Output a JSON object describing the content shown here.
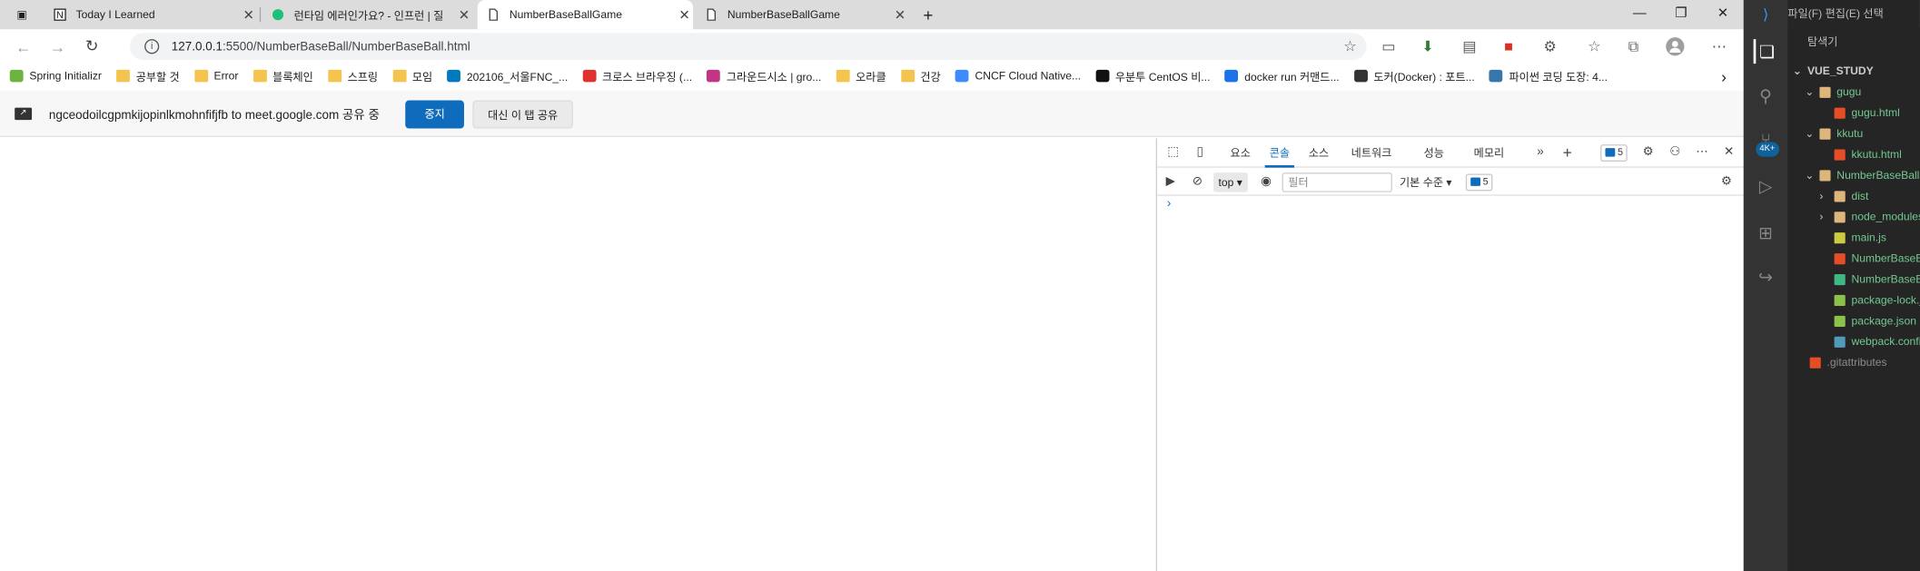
{
  "browser": {
    "tabs": [
      {
        "title": "Today I Learned",
        "icon": "notion-icon",
        "active": false
      },
      {
        "title": "런타임 에러인가요? - 인프런 | 질",
        "icon": "inflearn-icon",
        "active": false
      },
      {
        "title": "NumberBaseBallGame",
        "icon": "page-icon",
        "active": true
      },
      {
        "title": "NumberBaseBallGame",
        "icon": "page-icon",
        "active": false
      }
    ],
    "new_tab": "+",
    "url_host": "127.0.0.1",
    "url_path": ":5500/NumberBaseBall/NumberBaseBall.html",
    "bookmarks": [
      {
        "label": "Spring Initializr",
        "icon": "spring-icon"
      },
      {
        "label": "공부할 것",
        "icon": "folder-icon"
      },
      {
        "label": "Error",
        "icon": "folder-icon"
      },
      {
        "label": "블록체인",
        "icon": "folder-icon"
      },
      {
        "label": "스프링",
        "icon": "folder-icon"
      },
      {
        "label": "모임",
        "icon": "folder-icon"
      },
      {
        "label": "202106_서울FNC_...",
        "icon": "trello-icon"
      },
      {
        "label": "크로스 브라우징 (...",
        "icon": "w-icon"
      },
      {
        "label": "그라운드시소 | gro...",
        "icon": "instagram-icon"
      },
      {
        "label": "오라클",
        "icon": "folder-icon"
      },
      {
        "label": "건강",
        "icon": "folder-icon"
      },
      {
        "label": "CNCF Cloud Native...",
        "icon": "image-icon"
      },
      {
        "label": "우분투 CentOS 비...",
        "icon": "x-icon"
      },
      {
        "label": "docker run 커맨드...",
        "icon": "file-icon"
      },
      {
        "label": "도커(Docker) : 포트...",
        "icon": "dots-icon"
      },
      {
        "label": "파이썬 코딩 도장: 4...",
        "icon": "python-icon"
      }
    ],
    "infobar": {
      "message": "ngceodoilcgpmkijopinlkmohnfifjfb to meet.google.com 공유 중",
      "stop_label": "중지",
      "share_label": "대신 이 탭 공유"
    }
  },
  "devtools": {
    "tabs": [
      "요소",
      "콘솔",
      "소스",
      "네트워크",
      "성능",
      "메모리"
    ],
    "selected_tab": "콘솔",
    "more": "»",
    "add": "+",
    "issues_count": "5",
    "context": "top ▾",
    "filter_placeholder": "필터",
    "level": "기본 수준 ▾",
    "console_issues": "5",
    "prompt": "›"
  },
  "vscode": {
    "menu": "파일(F)   편집(E)   선택",
    "explorer_title": "탐색기",
    "project": "VUE_STUDY",
    "badge": "4K+",
    "tree": [
      {
        "label": "gugu",
        "type": "folder",
        "indent": 1,
        "color": "#73c991"
      },
      {
        "label": "gugu.html",
        "type": "html",
        "indent": 2,
        "color": "#73c991"
      },
      {
        "label": "kkutu",
        "type": "folder",
        "indent": 1,
        "color": "#73c991"
      },
      {
        "label": "kkutu.html",
        "type": "html",
        "indent": 2,
        "color": "#73c991"
      },
      {
        "label": "NumberBaseBall",
        "type": "folder",
        "indent": 1,
        "color": "#73c991"
      },
      {
        "label": "dist",
        "type": "folder-c",
        "indent": 2,
        "color": "#73c991"
      },
      {
        "label": "node_modules",
        "type": "folder-c",
        "indent": 2,
        "color": "#73c991"
      },
      {
        "label": "main.js",
        "type": "js",
        "indent": 2,
        "color": "#73c991"
      },
      {
        "label": "NumberBaseBall.html",
        "type": "html",
        "indent": 2,
        "color": "#73c991"
      },
      {
        "label": "NumberBaseBall.vue",
        "type": "vue",
        "indent": 2,
        "color": "#73c991"
      },
      {
        "label": "package-lock.json",
        "type": "json",
        "indent": 2,
        "color": "#73c991"
      },
      {
        "label": "package.json",
        "type": "json",
        "indent": 2,
        "color": "#73c991"
      },
      {
        "label": "webpack.config.js",
        "type": "config",
        "indent": 2,
        "color": "#73c991"
      },
      {
        "label": ".gitattributes",
        "type": "git",
        "indent": 1,
        "color": "#8c8c8c"
      }
    ]
  },
  "colors": {
    "accent": "#0f6cbd",
    "vscode_bg": "#252526",
    "activity_bg": "#333333"
  }
}
